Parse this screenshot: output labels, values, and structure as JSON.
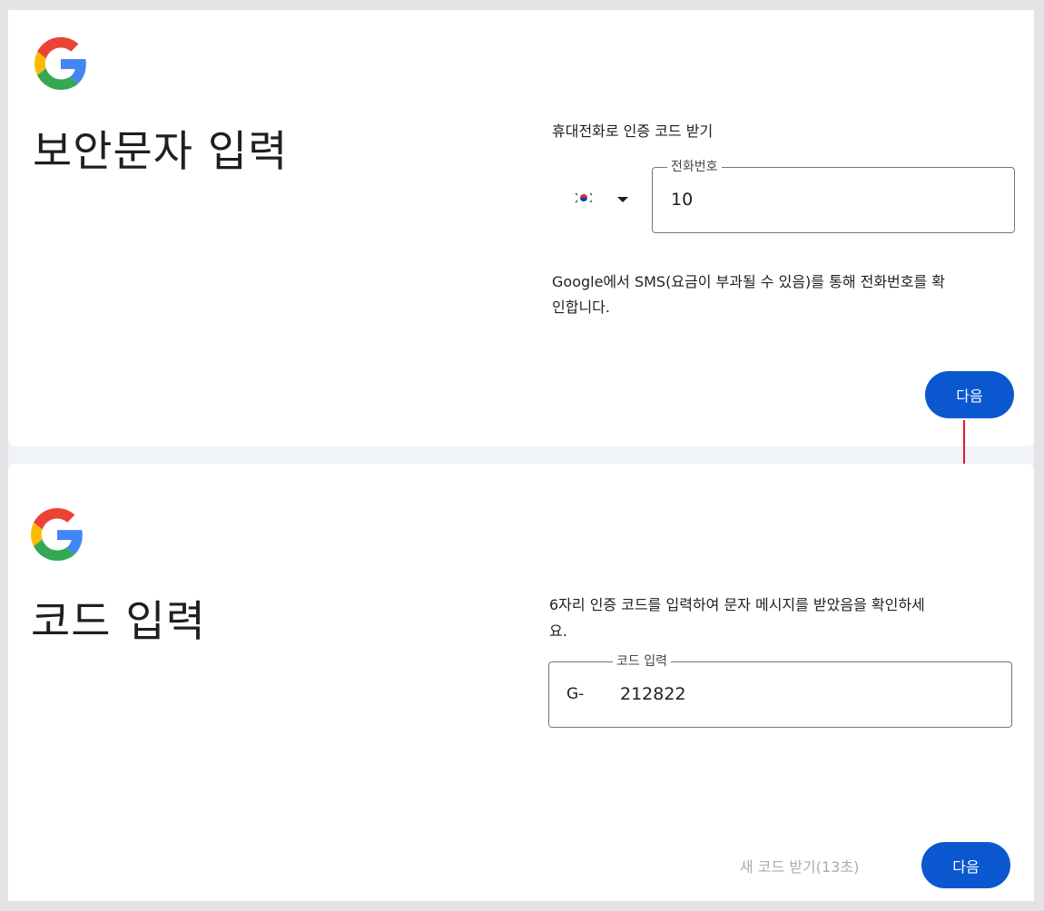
{
  "step1": {
    "title": "보안문자 입력",
    "caption": "휴대전화로 인증 코드 받기",
    "phone_field": {
      "label": "전화번호",
      "value": "10"
    },
    "country": {
      "flag": "south-korea-flag-icon"
    },
    "notice_line1": "Google에서 SMS(요금이 부과될 수 있음)를 통해 전화번호를 확",
    "notice_line2": "인합니다.",
    "next_label": "다음"
  },
  "step2": {
    "title": "코드 입력",
    "caption_line1": "6자리 인증 코드를 입력하여 문자 메시지를 받았음을 확인하세",
    "caption_line2": "요.",
    "code_field": {
      "label": "코드 입력",
      "prefix": "G-",
      "value": "212822"
    },
    "resend_label": "새 코드 받기(13초)",
    "next_label": "다음"
  },
  "colors": {
    "primary_button": "#0b57d0",
    "arrow": "#e21b23",
    "disabled_text": "#a9acb0"
  }
}
